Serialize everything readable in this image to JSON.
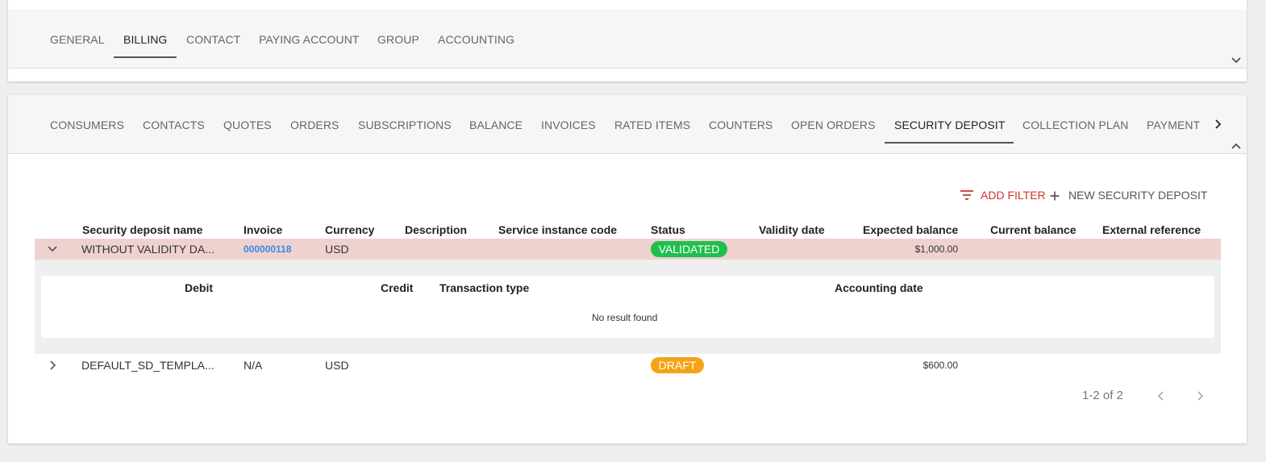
{
  "top_tabs": {
    "items": [
      {
        "label": "GENERAL"
      },
      {
        "label": "BILLING"
      },
      {
        "label": "CONTACT"
      },
      {
        "label": "PAYING ACCOUNT"
      },
      {
        "label": "GROUP"
      },
      {
        "label": "ACCOUNTING"
      }
    ],
    "active": "BILLING"
  },
  "sub_tabs": {
    "items": [
      {
        "label": "CONSUMERS"
      },
      {
        "label": "CONTACTS"
      },
      {
        "label": "QUOTES"
      },
      {
        "label": "ORDERS"
      },
      {
        "label": "SUBSCRIPTIONS"
      },
      {
        "label": "BALANCE"
      },
      {
        "label": "INVOICES"
      },
      {
        "label": "RATED ITEMS"
      },
      {
        "label": "COUNTERS"
      },
      {
        "label": "OPEN ORDERS"
      },
      {
        "label": "SECURITY DEPOSIT"
      },
      {
        "label": "COLLECTION PLAN"
      },
      {
        "label": "PAYMENT"
      }
    ],
    "active": "SECURITY DEPOSIT"
  },
  "toolbar": {
    "add_filter": "ADD FILTER",
    "new_deposit": "NEW SECURITY DEPOSIT"
  },
  "table": {
    "headers": {
      "name": "Security deposit name",
      "invoice": "Invoice",
      "currency": "Currency",
      "description": "Description",
      "service_instance_code": "Service instance code",
      "status": "Status",
      "validity_date": "Validity date",
      "expected_balance": "Expected balance",
      "current_balance": "Current balance",
      "external_reference": "External reference"
    },
    "rows": [
      {
        "name": "WITHOUT VALIDITY DA...",
        "invoice": "000000118",
        "currency": "USD",
        "status": "VALIDATED",
        "expected_balance": "$1,000.00",
        "expanded": true
      },
      {
        "name": "DEFAULT_SD_TEMPLA...",
        "invoice": "N/A",
        "currency": "USD",
        "status": "DRAFT",
        "expected_balance": "$600.00",
        "expanded": false
      }
    ],
    "sub_table": {
      "headers": {
        "debit": "Debit",
        "credit": "Credit",
        "transaction_type": "Transaction type",
        "accounting_date": "Accounting date"
      },
      "empty_text": "No result found"
    }
  },
  "pagination": {
    "range": "1-2 of 2"
  },
  "colors": {
    "validated": "#1fbf4e",
    "draft": "#f5a314",
    "selected_row": "#efd2d0",
    "filter_accent": "#d0342c",
    "link": "#3b86e0"
  }
}
